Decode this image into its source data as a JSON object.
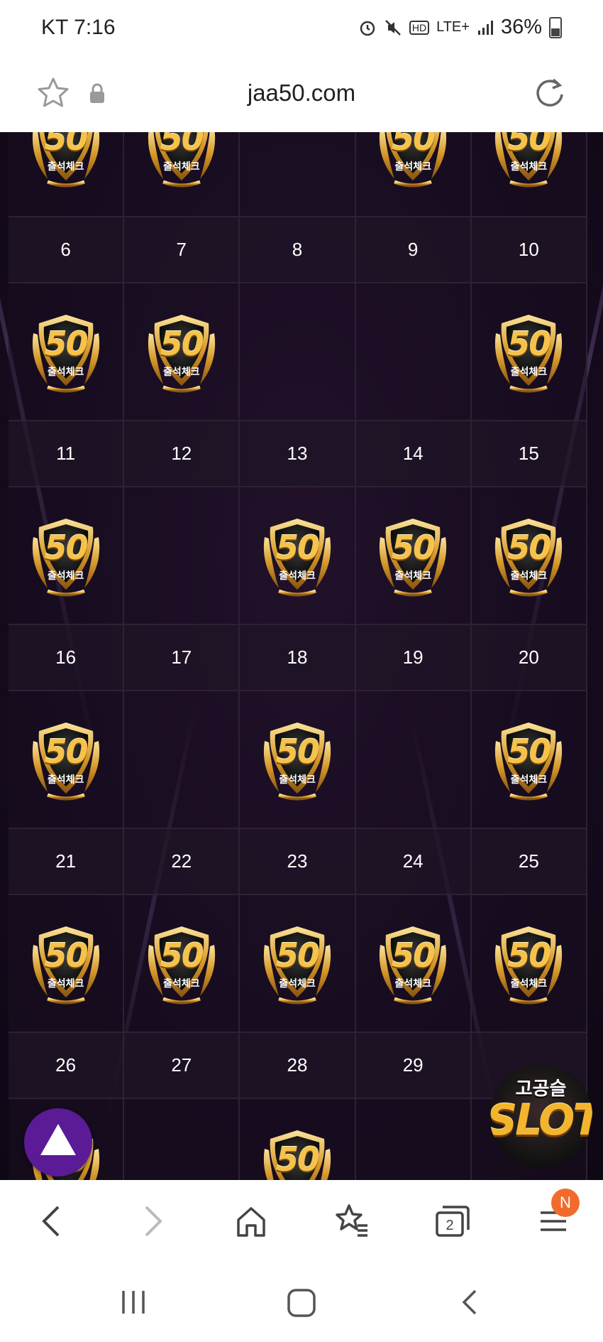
{
  "status_bar": {
    "carrier": "KT",
    "time": "7:16",
    "network": "LTE+",
    "battery": "36%"
  },
  "browser": {
    "url": "jaa50.com",
    "tab_count": "2",
    "menu_badge": "N"
  },
  "calendar": {
    "badge_number": "50",
    "badge_label": "출석체크",
    "top_badges": [
      true,
      true,
      false,
      true,
      true
    ],
    "weeks": [
      {
        "days": [
          "6",
          "7",
          "8",
          "9",
          "10"
        ],
        "checked": [
          true,
          true,
          false,
          false,
          true
        ]
      },
      {
        "days": [
          "11",
          "12",
          "13",
          "14",
          "15"
        ],
        "checked": [
          true,
          false,
          true,
          true,
          true
        ]
      },
      {
        "days": [
          "16",
          "17",
          "18",
          "19",
          "20"
        ],
        "checked": [
          true,
          false,
          true,
          false,
          true
        ]
      },
      {
        "days": [
          "21",
          "22",
          "23",
          "24",
          "25"
        ],
        "checked": [
          true,
          true,
          true,
          true,
          true
        ]
      },
      {
        "days": [
          "26",
          "27",
          "28",
          "29",
          ""
        ],
        "checked": [
          true,
          false,
          true,
          false,
          false
        ]
      }
    ]
  },
  "ad": {
    "line1": "고공슬",
    "line2": "SLOT"
  },
  "colors": {
    "accent_purple": "#5b1a96",
    "gold": "#f6c24a",
    "menu_badge": "#f26b2d"
  }
}
